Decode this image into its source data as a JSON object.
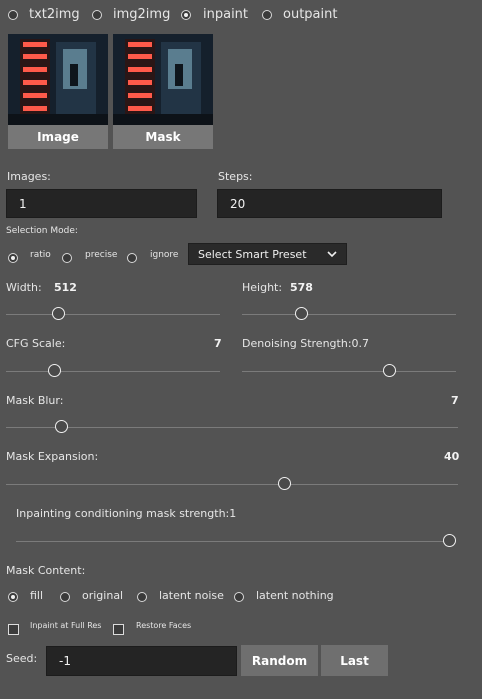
{
  "modes": [
    {
      "label": "txt2img",
      "checked": false
    },
    {
      "label": "img2img",
      "checked": false
    },
    {
      "label": "inpaint",
      "checked": true
    },
    {
      "label": "outpaint",
      "checked": false
    }
  ],
  "image_tabs": {
    "image": "Image",
    "mask": "Mask"
  },
  "images": {
    "label": "Images:",
    "value": "1"
  },
  "steps": {
    "label": "Steps:",
    "value": "20"
  },
  "selection_mode": {
    "label": "Selection Mode:",
    "options": [
      {
        "label": "ratio",
        "checked": true
      },
      {
        "label": "precise",
        "checked": false
      },
      {
        "label": "ignore",
        "checked": false
      }
    ],
    "preset": "Select Smart Preset"
  },
  "width": {
    "label": "Width:",
    "value": "512"
  },
  "height": {
    "label": "Height:",
    "value": "578"
  },
  "cfg_scale": {
    "label": "CFG Scale:",
    "value": "7"
  },
  "denoising": {
    "label": "Denoising Strength:0.7"
  },
  "mask_blur": {
    "label": "Mask Blur:",
    "value": "7"
  },
  "mask_expansion": {
    "label": "Mask Expansion:",
    "value": "40"
  },
  "inpaint_strength": {
    "label": "Inpainting conditioning mask strength:1"
  },
  "mask_content": {
    "label": "Mask Content:",
    "options": [
      {
        "label": "fill",
        "checked": true
      },
      {
        "label": "original",
        "checked": false
      },
      {
        "label": "latent noise",
        "checked": false
      },
      {
        "label": "latent nothing",
        "checked": false
      }
    ]
  },
  "checkboxes": {
    "inpaint_full_res": "Inpaint at Full Res",
    "restore_faces": "Restore Faces"
  },
  "seed": {
    "label": "Seed:",
    "value": "-1",
    "random": "Random",
    "last": "Last"
  }
}
